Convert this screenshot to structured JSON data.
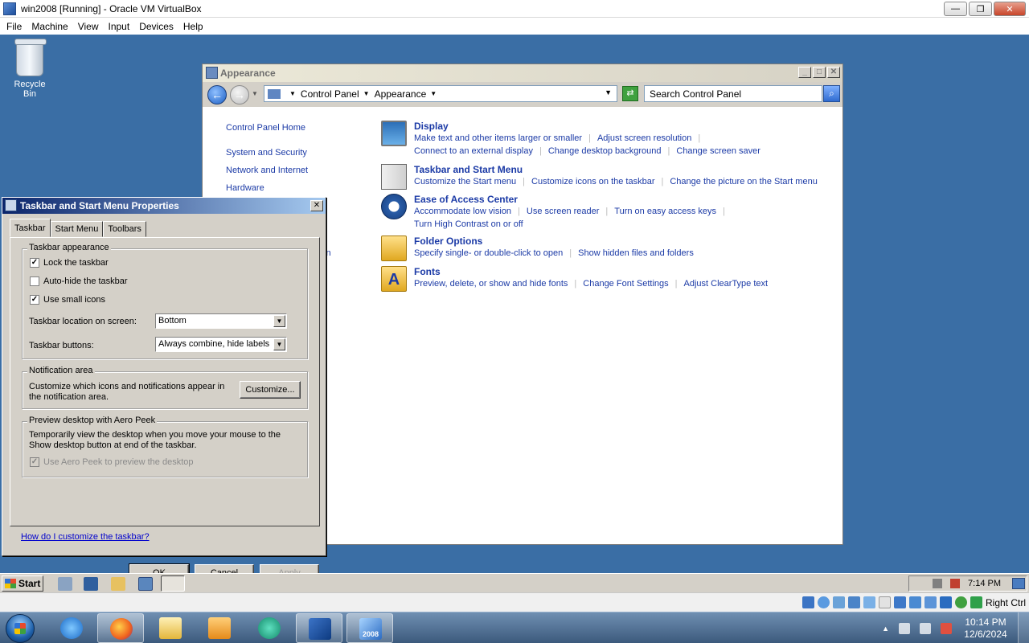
{
  "host_window": {
    "title": "win2008 [Running] - Oracle VM VirtualBox",
    "menu": [
      "File",
      "Machine",
      "View",
      "Input",
      "Devices",
      "Help"
    ],
    "minimize": "—",
    "maximize": "❐",
    "close": "✕"
  },
  "desktop": {
    "recycle_bin": "Recycle Bin"
  },
  "control_panel": {
    "title": "Appearance",
    "breadcrumb": [
      "Control Panel",
      "Appearance"
    ],
    "search_placeholder": "Search Control Panel",
    "left_nav": [
      "Control Panel Home",
      "System and Security",
      "Network and Internet",
      "Hardware"
    ],
    "hidden_nav_fragment": "ion",
    "sections": [
      {
        "title": "Display",
        "links": [
          "Make text and other items larger or smaller",
          "Adjust screen resolution",
          "Connect to an external display",
          "Change desktop background",
          "Change screen saver"
        ]
      },
      {
        "title": "Taskbar and Start Menu",
        "links": [
          "Customize the Start menu",
          "Customize icons on the taskbar",
          "Change the picture on the Start menu"
        ]
      },
      {
        "title": "Ease of Access Center",
        "links": [
          "Accommodate low vision",
          "Use screen reader",
          "Turn on easy access keys",
          "Turn High Contrast on or off"
        ]
      },
      {
        "title": "Folder Options",
        "links": [
          "Specify single- or double-click to open",
          "Show hidden files and folders"
        ]
      },
      {
        "title": "Fonts",
        "links": [
          "Preview, delete, or show and hide fonts",
          "Change Font Settings",
          "Adjust ClearType text"
        ]
      }
    ]
  },
  "dialog": {
    "title": "Taskbar and Start Menu Properties",
    "tabs": [
      "Taskbar",
      "Start Menu",
      "Toolbars"
    ],
    "active_tab": "Taskbar",
    "appearance": {
      "legend": "Taskbar appearance",
      "lock_taskbar": "Lock the taskbar",
      "lock_taskbar_checked": true,
      "auto_hide": "Auto-hide the taskbar",
      "auto_hide_checked": false,
      "small_icons": "Use small icons",
      "small_icons_checked": true,
      "location_label": "Taskbar location on screen:",
      "location_value": "Bottom",
      "buttons_label": "Taskbar buttons:",
      "buttons_value": "Always combine, hide labels"
    },
    "notification": {
      "legend": "Notification area",
      "text": "Customize which icons and notifications appear in the notification area.",
      "customize_button": "Customize..."
    },
    "aero_peek": {
      "legend": "Preview desktop with Aero Peek",
      "text": "Temporarily view the desktop when you move your mouse to the Show desktop button at end of the taskbar.",
      "checkbox": "Use Aero Peek to preview the desktop",
      "checked": true,
      "disabled": true
    },
    "help_link": "How do I customize the taskbar?",
    "ok": "OK",
    "cancel": "Cancel",
    "apply": "Apply"
  },
  "guest_taskbar": {
    "start": "Start",
    "clock": "7:14 PM"
  },
  "vbox_status": {
    "host_key": "Right Ctrl"
  },
  "host_taskbar": {
    "time": "10:14 PM",
    "date": "12/6/2024",
    "vm_badge": "2008"
  }
}
